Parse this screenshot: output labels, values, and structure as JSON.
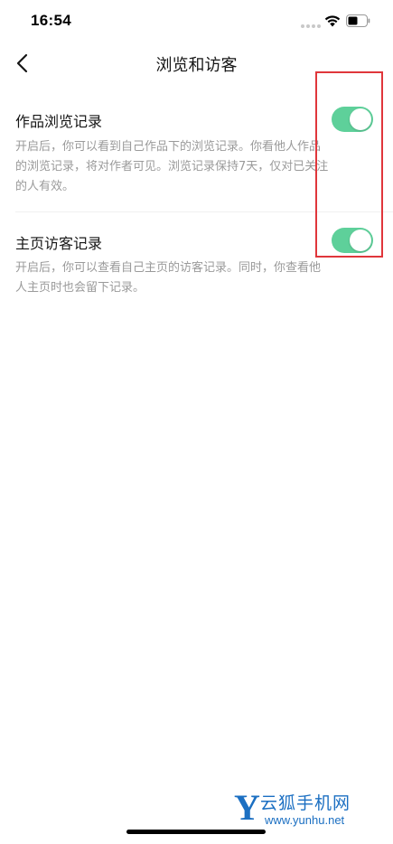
{
  "status_bar": {
    "time": "16:54"
  },
  "nav": {
    "title": "浏览和访客"
  },
  "settings": [
    {
      "title": "作品浏览记录",
      "enabled": true,
      "description_lines": [
        "开启后，你可以看到自己作品下的浏览记录。你看他人作品",
        "的浏览记录，将对作者可见。浏览记录保持7天，仅对已关注",
        "的人有效。"
      ]
    },
    {
      "title": "主页访客记录",
      "enabled": true,
      "description_lines": [
        "开启后，你可以查看自己主页的访客记录。同时，你查看他",
        "人主页时也会留下记录。"
      ]
    }
  ],
  "colors": {
    "toggle_on": "#5ed09a",
    "highlight": "#e0363b",
    "watermark": "#1b6fc2"
  },
  "watermark": {
    "letter": "Y",
    "name": "云狐手机网",
    "url": "www.yunhu.net"
  }
}
